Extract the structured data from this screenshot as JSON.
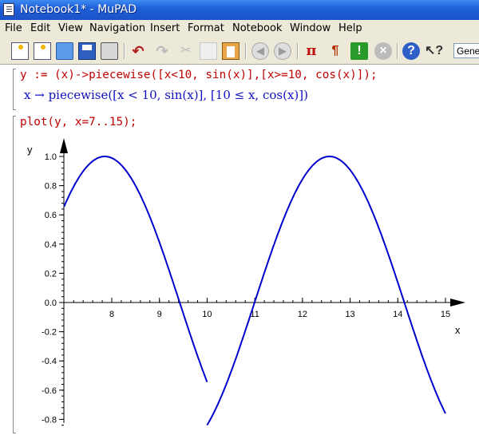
{
  "window": {
    "title": "Notebook1* - MuPAD"
  },
  "menu": [
    "File",
    "Edit",
    "View",
    "Navigation",
    "Insert",
    "Format",
    "Notebook",
    "Window",
    "Help"
  ],
  "toolbar": {
    "icons": [
      "new-notebook-icon",
      "new-document-icon",
      "open-icon",
      "save-icon",
      "print-icon",
      "undo-icon",
      "redo-icon",
      "cut-icon",
      "copy-icon",
      "paste-icon",
      "back-icon",
      "forward-icon",
      "insert-math-icon",
      "insert-text-icon",
      "evaluate-icon",
      "stop-icon",
      "help-icon",
      "context-help-icon"
    ],
    "style_value": "Gene"
  },
  "cells": {
    "input1": "y := (x)->piecewise([x<10, sin(x)],[x>=10, cos(x)]);",
    "output1": "x → piecewise([x < 10, sin(x)], [10 ≤ x, cos(x)])",
    "input2": "plot(y, x=7..15);"
  },
  "chart_data": {
    "type": "line",
    "xlabel": "x",
    "ylabel": "y",
    "xlim": [
      7,
      15
    ],
    "ylim": [
      -0.85,
      1.05
    ],
    "x_ticks": [
      8,
      9,
      10,
      11,
      12,
      13,
      14,
      15
    ],
    "y_ticks": [
      1.0,
      0.8,
      0.6,
      0.4,
      0.2,
      0.0,
      -0.2,
      -0.4,
      -0.6,
      -0.8
    ],
    "y_tick_labels": [
      "1.0",
      "0.8",
      "0.6",
      "0.4",
      "0.2",
      "0.0",
      "-0.2",
      "-0.4",
      "-0.6",
      "-0.8"
    ],
    "series": [
      {
        "x_range": [
          7,
          10
        ],
        "function": "sin(x)",
        "color": "#0000cc"
      },
      {
        "x_range": [
          10,
          15
        ],
        "function": "cos(x)",
        "color": "#0000cc"
      }
    ]
  }
}
